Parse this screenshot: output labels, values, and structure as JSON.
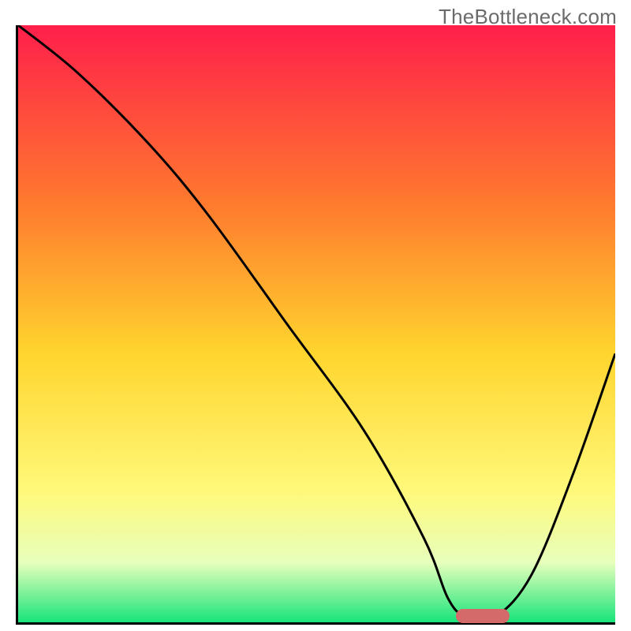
{
  "watermark": "TheBottleneck.com",
  "colors": {
    "gradient_top": "#ff1f4b",
    "gradient_mid_upper": "#ff7a2e",
    "gradient_mid": "#ffd52e",
    "gradient_mid_lower": "#fff97a",
    "gradient_lower": "#e7ffbc",
    "gradient_bottom": "#18e47a",
    "curve": "#000000",
    "bar_fill": "#d46a6a",
    "axis": "#000000"
  },
  "chart_data": {
    "type": "line",
    "title": "",
    "xlabel": "",
    "ylabel": "",
    "xlim": [
      0,
      100
    ],
    "ylim": [
      0,
      100
    ],
    "series": [
      {
        "name": "bottleneck-curve",
        "x": [
          0,
          10,
          22,
          32,
          45,
          58,
          68,
          72,
          75,
          80,
          86,
          93,
          100
        ],
        "y": [
          100,
          92,
          80,
          68,
          50,
          32,
          14,
          4,
          1,
          1,
          8,
          25,
          45
        ]
      }
    ],
    "optimal_marker": {
      "x_start": 73,
      "x_end": 82,
      "y": 1
    },
    "gradient_stops": [
      {
        "pct": 0,
        "color": "#ff1f4b"
      },
      {
        "pct": 30,
        "color": "#ff7a2e"
      },
      {
        "pct": 55,
        "color": "#ffd52e"
      },
      {
        "pct": 78,
        "color": "#fff97a"
      },
      {
        "pct": 90,
        "color": "#e7ffbc"
      },
      {
        "pct": 100,
        "color": "#18e47a"
      }
    ]
  }
}
